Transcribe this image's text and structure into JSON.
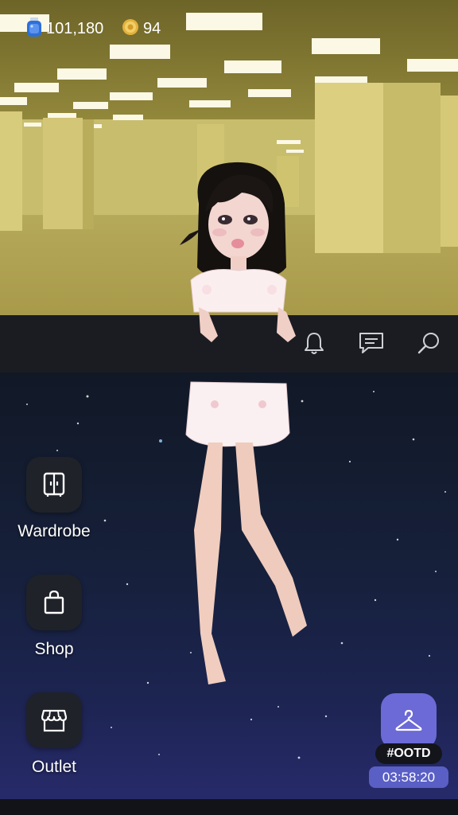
{
  "currencies": {
    "gems": {
      "value": "101,180",
      "icon": "gem-jar-icon",
      "color": "#2e6fd8"
    },
    "coins": {
      "value": "94",
      "icon": "coin-icon",
      "color": "#e3b23c"
    }
  },
  "header_icons": [
    "bell-icon",
    "chat-icon",
    "search-icon"
  ],
  "side_menu": [
    {
      "label": "Wardrobe",
      "icon": "wardrobe-icon"
    },
    {
      "label": "Shop",
      "icon": "shopping-bag-icon"
    },
    {
      "label": "Outlet",
      "icon": "storefront-icon"
    }
  ],
  "ootd": {
    "tag": "#OOTD",
    "timer": "03:58:20",
    "icon": "hanger-icon",
    "accent": "#6b6ad6"
  }
}
